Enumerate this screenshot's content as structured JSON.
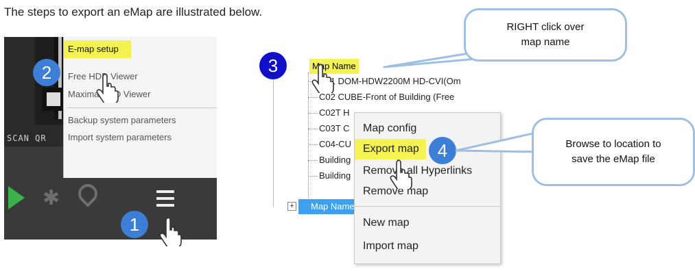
{
  "intro_text": "The steps to export an eMap are illustrated below.",
  "left_shot": {
    "scan_label": "SCAN QR",
    "menu": [
      {
        "label": "E-map setup",
        "highlighted": true
      },
      {
        "label": "Free HDD Viewer",
        "highlighted": false
      },
      {
        "label": "Maxima HDD Viewer",
        "highlighted": false
      },
      {
        "label": "Backup system parameters",
        "highlighted": false
      },
      {
        "label": "Import system parameters",
        "highlighted": false
      }
    ],
    "toolbar_icons": [
      "play-icon",
      "gear-icon",
      "location-pin-icon",
      "hamburger-menu-icon"
    ]
  },
  "right_shot": {
    "tree_root": "Map Name",
    "tree_items": [
      "C01 DOM-HDW2200M HD-CVI(Om",
      "C02 CUBE-Front of Building (Free",
      "C02T H",
      "C03T C",
      "C04-CU",
      "Building",
      "Building"
    ],
    "tree_root_2": "Map Name",
    "context_menu": [
      {
        "label": "Map config",
        "highlighted": false
      },
      {
        "label": "Export map",
        "highlighted": true
      },
      {
        "label": "Remove all Hyperlinks",
        "highlighted": false
      },
      {
        "label": "Remove map",
        "highlighted": false
      },
      {
        "label": "New map",
        "highlighted": false
      },
      {
        "label": "Import map",
        "highlighted": false
      }
    ]
  },
  "steps": {
    "step1": "1",
    "step2": "2",
    "step3": "3",
    "step4": "4"
  },
  "callouts": {
    "right_click_l1": "RIGHT click over",
    "right_click_l2": "map name",
    "browse_l1": "Browse to location to",
    "browse_l2": "save the eMap file"
  },
  "colors": {
    "highlight": "#f5f254",
    "badge_blue": "#3d7fd6",
    "badge_dark": "#1010c8",
    "callout_border": "#9dbfe3",
    "selected_tree": "#3ea0f0"
  }
}
